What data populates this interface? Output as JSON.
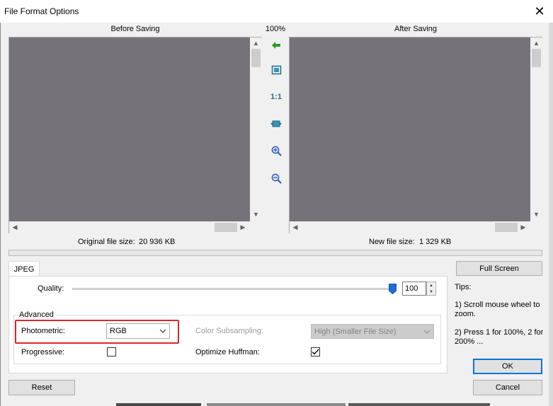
{
  "window": {
    "title": "File Format Options",
    "close_glyph": "✕"
  },
  "preview": {
    "before_label": "Before Saving",
    "after_label": "After Saving",
    "zoom_level": "100%",
    "original_size_label": "Original file size:",
    "original_size_value": "20 936 KB",
    "new_size_label": "New file size:",
    "new_size_value": "1 329 KB",
    "background_color": "#757379"
  },
  "toolbar": {
    "sync_icon": "arrow-left-icon",
    "fit_icon": "fit-window-icon",
    "one_to_one_label": "1:1",
    "fit_width_icon": "fit-width-icon",
    "zoom_in_icon": "zoom-in-icon",
    "zoom_out_icon": "zoom-out-icon"
  },
  "tabs": [
    {
      "label": "JPEG",
      "active": true
    }
  ],
  "jpeg": {
    "quality_label": "Quality:",
    "quality_value": "100",
    "quality_level_percent": 100,
    "advanced_label": "Advanced",
    "photometric_label": "Photometric:",
    "photometric_value": "RGB",
    "progressive_label": "Progressive:",
    "progressive_checked": false,
    "color_subsampling_label": "Color Subsampling:",
    "color_subsampling_value": "High (Smaller File Size)",
    "optimize_huffman_label": "Optimize Huffman:",
    "optimize_huffman_checked": true
  },
  "buttons": {
    "full_screen": "Full Screen",
    "ok": "OK",
    "cancel": "Cancel",
    "reset": "Reset"
  },
  "tips": {
    "title": "Tips:",
    "tip1": "1) Scroll mouse wheel to zoom.",
    "tip2": "2) Press 1 for 100%, 2 for 200% ..."
  },
  "colors": {
    "accent": "#0078d7",
    "highlight": "#d9262c",
    "slider_thumb": "#1e6fd0",
    "tool_green": "#22a020",
    "tool_teal": "#1a6f8a",
    "tool_blue": "#2a58b8"
  }
}
